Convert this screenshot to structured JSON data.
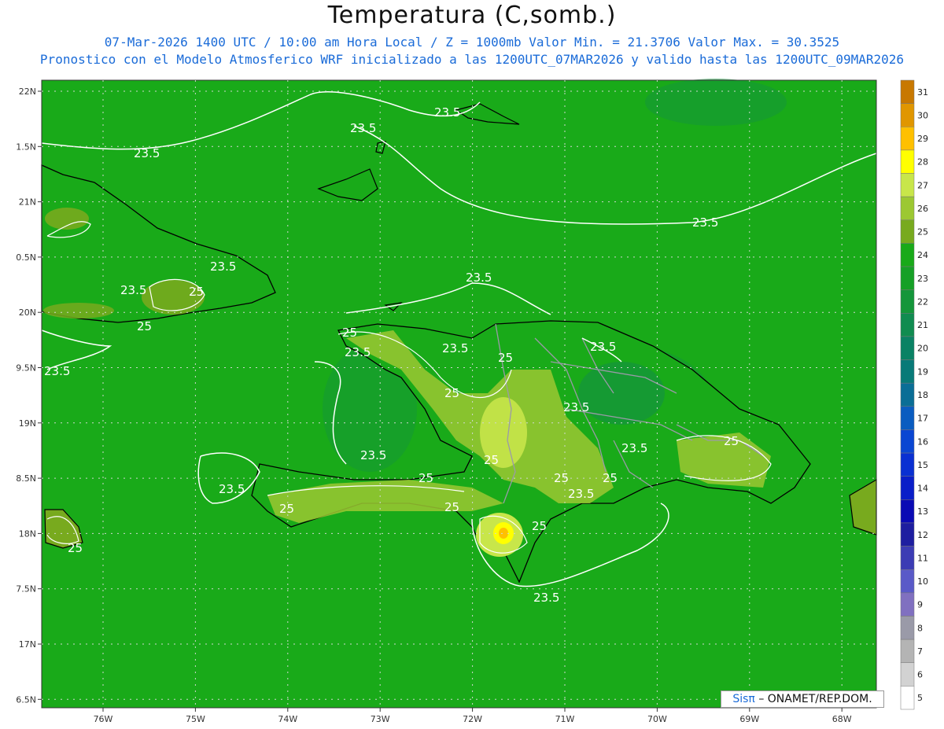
{
  "header": {
    "title": "Temperatura (C,somb.)",
    "subtitle1": "07-Mar-2026 1400 UTC / 10:00 am Hora Local / Z = 1000mb  Valor Min. = 21.3706  Valor Max. = 30.3525",
    "subtitle2": "Pronostico con el Modelo Atmosferico WRF inicializado a las 1200UTC_07MAR2026 y valido hasta las  1200UTC_09MAR2026"
  },
  "axes": {
    "lat_labels": [
      "22N",
      "1.5N",
      "21N",
      "0.5N",
      "20N",
      "9.5N",
      "19N",
      "8.5N",
      "18N",
      "7.5N",
      "17N",
      "6.5N"
    ],
    "lon_labels": [
      "76W",
      "75W",
      "74W",
      "73W",
      "72W",
      "71W",
      "70W",
      "69W",
      "68W"
    ]
  },
  "colorbar": {
    "levels": [
      "31",
      "30",
      "29",
      "28",
      "27",
      "26",
      "25",
      "24",
      "23",
      "22",
      "21",
      "20",
      "19",
      "18",
      "17",
      "16",
      "15",
      "14",
      "13",
      "12",
      "11",
      "10",
      "9",
      "8",
      "7",
      "6",
      "5"
    ],
    "colors": [
      "#c87800",
      "#e09600",
      "#ffc000",
      "#ffff00",
      "#c8e64a",
      "#9cc832",
      "#78aa1e",
      "#19aa19",
      "#16a026",
      "#14963a",
      "#108c50",
      "#0a8264",
      "#087a78",
      "#0a6e96",
      "#0a5cc0",
      "#0a46d2",
      "#0a30d2",
      "#0a1ec8",
      "#0a0ab4",
      "#1e1ea0",
      "#3c3cb4",
      "#5a5ac8",
      "#8070c0",
      "#9a9aa8",
      "#b4b4b4",
      "#d2d2d2",
      "#ffffff"
    ]
  },
  "contours": {
    "label_a": "23.5",
    "label_b": "25"
  },
  "credit": {
    "logo": "Sisπ",
    "text": "– ONAMET/REP.DOM."
  }
}
